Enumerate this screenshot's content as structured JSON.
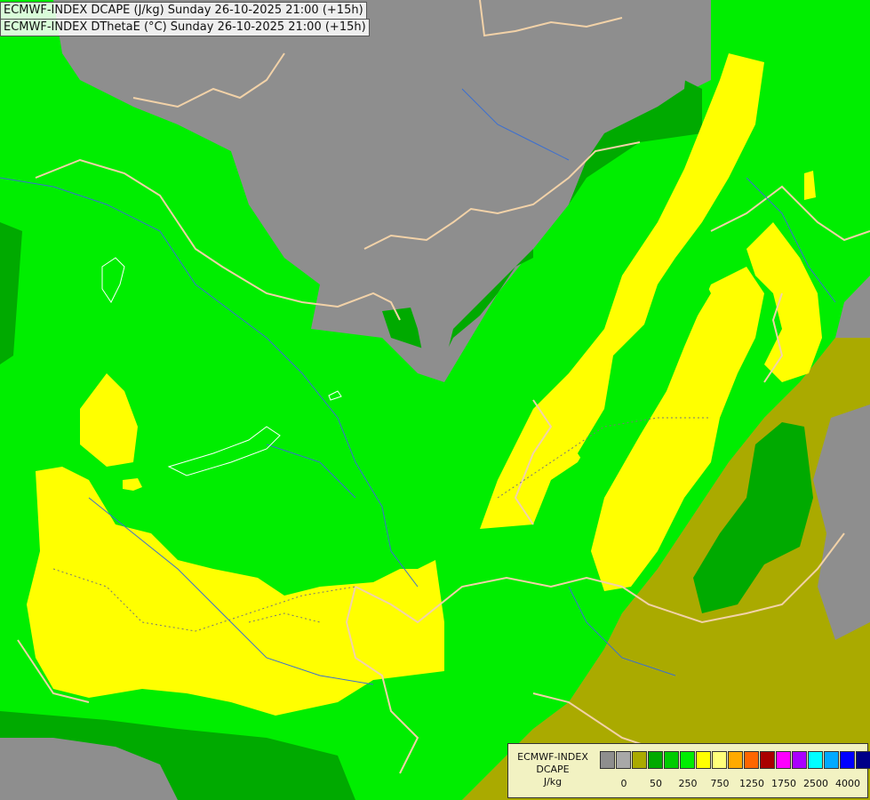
{
  "titles": {
    "line1": "ECMWF-INDEX DCAPE (J/kg) Sunday 26-10-2025 21:00 (+15h)",
    "line2": "ECMWF-INDEX DThetaE (°C) Sunday 26-10-2025 21:00 (+15h)"
  },
  "map_colors": {
    "background_gray": "#8e8e8e",
    "light_green": "#00ee00",
    "dark_green": "#00aa00",
    "olive": "#aaaa00",
    "yellow": "#ffff00",
    "border": "#f2d2a8",
    "river": "#3b6fd1"
  },
  "legend": {
    "name_line1": "ECMWF-INDEX",
    "name_line2": "DCAPE",
    "name_line3": "J/kg",
    "colors": [
      "#8e8e8e",
      "#a8a8a8",
      "#aaaa00",
      "#00aa00",
      "#00cc00",
      "#00ee00",
      "#ffff00",
      "#ffff7a",
      "#ffaa00",
      "#ff6600",
      "#aa0000",
      "#ff00ff",
      "#aa00ff",
      "#00ffff",
      "#00aaff",
      "#0000ff",
      "#000088"
    ],
    "ticks": [
      "0",
      "50",
      "250",
      "750",
      "1250",
      "1750",
      "2500",
      "4000"
    ]
  }
}
